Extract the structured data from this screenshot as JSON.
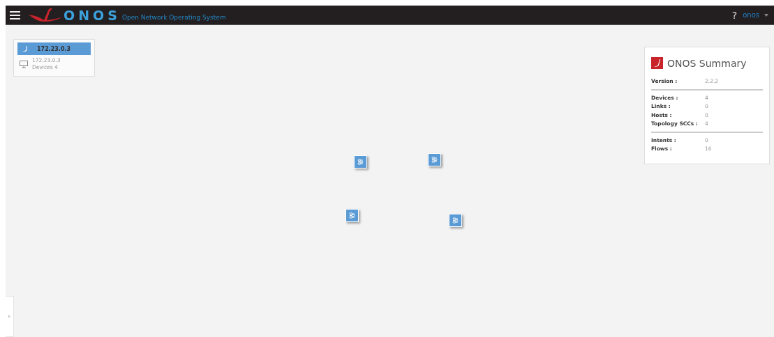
{
  "header": {
    "logo_text": "ONOS",
    "subtitle": "Open Network Operating System",
    "help": "?",
    "user": "onos"
  },
  "instance_panel": {
    "instances": [
      {
        "title": "172.23.0.3",
        "address": "172.23.0.3",
        "devices": "Devices 4",
        "selected": true
      }
    ]
  },
  "topology": {
    "devices": [
      {
        "kind": "switch"
      },
      {
        "kind": "switch"
      },
      {
        "kind": "switch"
      },
      {
        "kind": "switch"
      }
    ]
  },
  "summary": {
    "title": "ONOS Summary",
    "sections": [
      [
        {
          "label": "Version :",
          "value": "2.2.2"
        }
      ],
      [
        {
          "label": "Devices :",
          "value": "4"
        },
        {
          "label": "Links :",
          "value": "0"
        },
        {
          "label": "Hosts :",
          "value": "0"
        },
        {
          "label": "Topology SCCs :",
          "value": "4"
        }
      ],
      [
        {
          "label": "Intents :",
          "value": "0"
        },
        {
          "label": "Flows :",
          "value": "16"
        }
      ]
    ]
  }
}
